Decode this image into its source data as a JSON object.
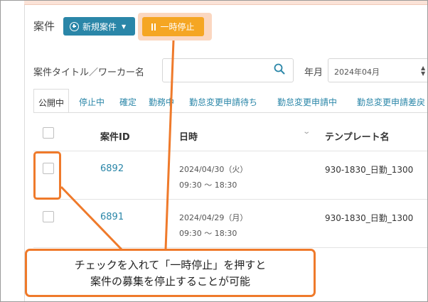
{
  "header": {
    "title": "案件",
    "new_button_label": "新規案件",
    "pause_button_label": "一時停止"
  },
  "filters": {
    "search_label": "案件タイトル／ワーカー名",
    "search_value": "",
    "month_label": "年月",
    "month_value": "2024年04月"
  },
  "tabs": [
    {
      "label": "公開中",
      "active": true
    },
    {
      "label": "停止中",
      "active": false
    },
    {
      "label": "確定",
      "active": false
    },
    {
      "label": "勤務中",
      "active": false
    },
    {
      "label": "勤怠変更申請待ち",
      "active": false
    },
    {
      "label": "勤怠変更申請中",
      "active": false
    },
    {
      "label": "勤怠変更申請差戻",
      "active": false
    }
  ],
  "table": {
    "columns": [
      "案件ID",
      "日時",
      "テンプレート名"
    ],
    "rows": [
      {
        "id": "6892",
        "date": "2024/04/30（火）",
        "time": "09:30 ～ 18:30",
        "template": "930-1830_日勤_1300",
        "checked": false
      },
      {
        "id": "6891",
        "date": "2024/04/29（月）",
        "time": "09:30 ～ 18:30",
        "template": "930-1830_日勤_1300",
        "checked": false
      }
    ]
  },
  "annotation": {
    "line1": "チェックを入れて「一時停止」を押すと",
    "line2": "案件の募集を停止することが可能",
    "color": "#ef7a2b"
  },
  "colors": {
    "primary": "#2a86a8",
    "pause": "#f5a623",
    "highlight": "#ef7a2b"
  },
  "icons": {
    "new_button": "plus-circle-icon",
    "new_caret": "caret-down-icon",
    "pause_button": "pause-icon",
    "search": "search-icon",
    "sort": "chevron-down-icon",
    "month_select": "select-arrows-icon"
  }
}
